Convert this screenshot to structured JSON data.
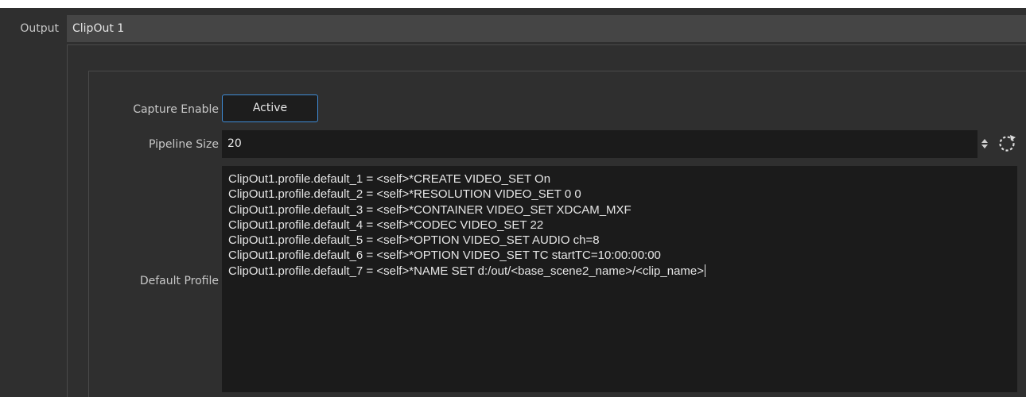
{
  "output": {
    "label": "Output",
    "tab_title": "ClipOut 1"
  },
  "fields": {
    "capture_enable": {
      "label": "Capture Enable",
      "button_label": "Active"
    },
    "pipeline_size": {
      "label": "Pipeline Size",
      "value": "20"
    },
    "default_profile": {
      "label": "Default Profile",
      "lines": [
        "ClipOut1.profile.default_1 = <self>*CREATE VIDEO_SET On",
        "ClipOut1.profile.default_2 = <self>*RESOLUTION VIDEO_SET 0 0",
        "ClipOut1.profile.default_3 = <self>*CONTAINER VIDEO_SET XDCAM_MXF",
        "ClipOut1.profile.default_4 = <self>*CODEC VIDEO_SET 22",
        "ClipOut1.profile.default_5 = <self>*OPTION VIDEO_SET AUDIO ch=8",
        "ClipOut1.profile.default_6 = <self>*OPTION VIDEO_SET TC startTC=10:00:00:00",
        "ClipOut1.profile.default_7 = <self>*NAME SET d:/out/<base_scene2_name>/<clip_name>"
      ]
    }
  },
  "icons": {
    "spin": "spinbox-arrows-icon",
    "reset": "reset-icon"
  },
  "colors": {
    "accent_border": "#3f8cd6",
    "panel_bg": "#2f2f2f",
    "field_bg": "#1b1b1b",
    "tab_bg": "#454545"
  }
}
